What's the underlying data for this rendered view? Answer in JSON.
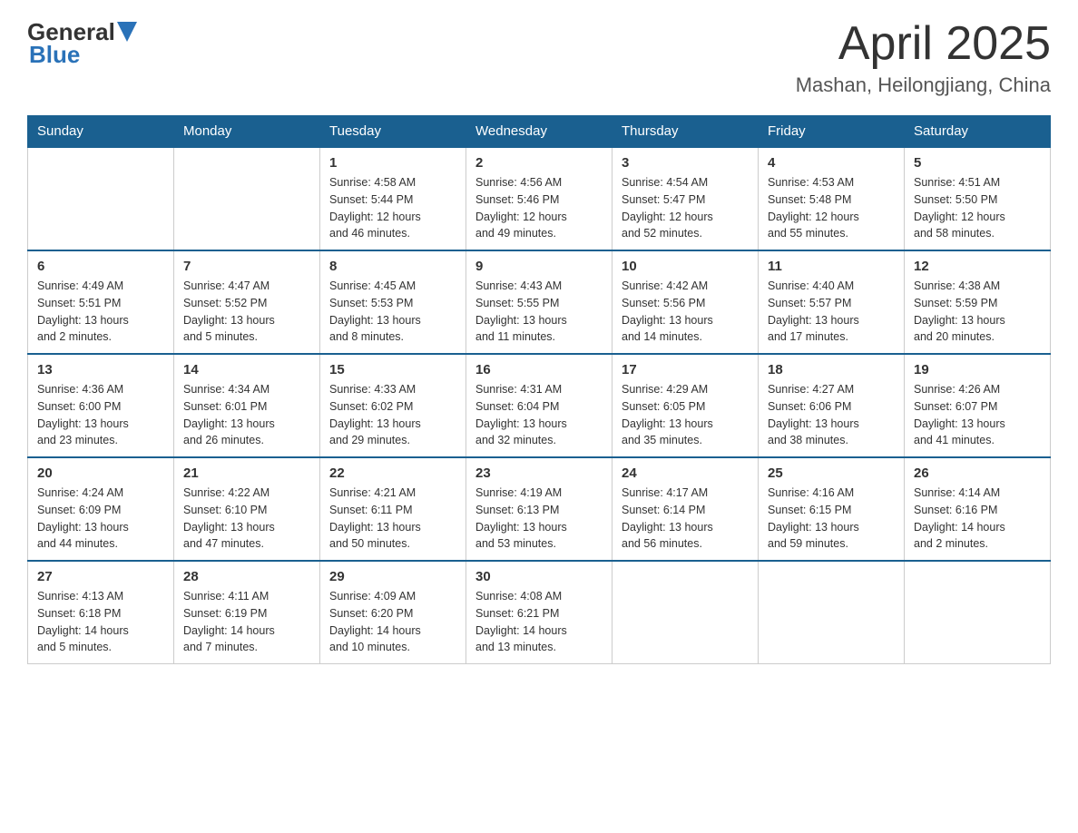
{
  "header": {
    "logo": {
      "general": "General",
      "blue": "Blue"
    },
    "month": "April 2025",
    "location": "Mashan, Heilongjiang, China"
  },
  "weekdays": [
    "Sunday",
    "Monday",
    "Tuesday",
    "Wednesday",
    "Thursday",
    "Friday",
    "Saturday"
  ],
  "weeks": [
    [
      {
        "day": "",
        "info": ""
      },
      {
        "day": "",
        "info": ""
      },
      {
        "day": "1",
        "info": "Sunrise: 4:58 AM\nSunset: 5:44 PM\nDaylight: 12 hours\nand 46 minutes."
      },
      {
        "day": "2",
        "info": "Sunrise: 4:56 AM\nSunset: 5:46 PM\nDaylight: 12 hours\nand 49 minutes."
      },
      {
        "day": "3",
        "info": "Sunrise: 4:54 AM\nSunset: 5:47 PM\nDaylight: 12 hours\nand 52 minutes."
      },
      {
        "day": "4",
        "info": "Sunrise: 4:53 AM\nSunset: 5:48 PM\nDaylight: 12 hours\nand 55 minutes."
      },
      {
        "day": "5",
        "info": "Sunrise: 4:51 AM\nSunset: 5:50 PM\nDaylight: 12 hours\nand 58 minutes."
      }
    ],
    [
      {
        "day": "6",
        "info": "Sunrise: 4:49 AM\nSunset: 5:51 PM\nDaylight: 13 hours\nand 2 minutes."
      },
      {
        "day": "7",
        "info": "Sunrise: 4:47 AM\nSunset: 5:52 PM\nDaylight: 13 hours\nand 5 minutes."
      },
      {
        "day": "8",
        "info": "Sunrise: 4:45 AM\nSunset: 5:53 PM\nDaylight: 13 hours\nand 8 minutes."
      },
      {
        "day": "9",
        "info": "Sunrise: 4:43 AM\nSunset: 5:55 PM\nDaylight: 13 hours\nand 11 minutes."
      },
      {
        "day": "10",
        "info": "Sunrise: 4:42 AM\nSunset: 5:56 PM\nDaylight: 13 hours\nand 14 minutes."
      },
      {
        "day": "11",
        "info": "Sunrise: 4:40 AM\nSunset: 5:57 PM\nDaylight: 13 hours\nand 17 minutes."
      },
      {
        "day": "12",
        "info": "Sunrise: 4:38 AM\nSunset: 5:59 PM\nDaylight: 13 hours\nand 20 minutes."
      }
    ],
    [
      {
        "day": "13",
        "info": "Sunrise: 4:36 AM\nSunset: 6:00 PM\nDaylight: 13 hours\nand 23 minutes."
      },
      {
        "day": "14",
        "info": "Sunrise: 4:34 AM\nSunset: 6:01 PM\nDaylight: 13 hours\nand 26 minutes."
      },
      {
        "day": "15",
        "info": "Sunrise: 4:33 AM\nSunset: 6:02 PM\nDaylight: 13 hours\nand 29 minutes."
      },
      {
        "day": "16",
        "info": "Sunrise: 4:31 AM\nSunset: 6:04 PM\nDaylight: 13 hours\nand 32 minutes."
      },
      {
        "day": "17",
        "info": "Sunrise: 4:29 AM\nSunset: 6:05 PM\nDaylight: 13 hours\nand 35 minutes."
      },
      {
        "day": "18",
        "info": "Sunrise: 4:27 AM\nSunset: 6:06 PM\nDaylight: 13 hours\nand 38 minutes."
      },
      {
        "day": "19",
        "info": "Sunrise: 4:26 AM\nSunset: 6:07 PM\nDaylight: 13 hours\nand 41 minutes."
      }
    ],
    [
      {
        "day": "20",
        "info": "Sunrise: 4:24 AM\nSunset: 6:09 PM\nDaylight: 13 hours\nand 44 minutes."
      },
      {
        "day": "21",
        "info": "Sunrise: 4:22 AM\nSunset: 6:10 PM\nDaylight: 13 hours\nand 47 minutes."
      },
      {
        "day": "22",
        "info": "Sunrise: 4:21 AM\nSunset: 6:11 PM\nDaylight: 13 hours\nand 50 minutes."
      },
      {
        "day": "23",
        "info": "Sunrise: 4:19 AM\nSunset: 6:13 PM\nDaylight: 13 hours\nand 53 minutes."
      },
      {
        "day": "24",
        "info": "Sunrise: 4:17 AM\nSunset: 6:14 PM\nDaylight: 13 hours\nand 56 minutes."
      },
      {
        "day": "25",
        "info": "Sunrise: 4:16 AM\nSunset: 6:15 PM\nDaylight: 13 hours\nand 59 minutes."
      },
      {
        "day": "26",
        "info": "Sunrise: 4:14 AM\nSunset: 6:16 PM\nDaylight: 14 hours\nand 2 minutes."
      }
    ],
    [
      {
        "day": "27",
        "info": "Sunrise: 4:13 AM\nSunset: 6:18 PM\nDaylight: 14 hours\nand 5 minutes."
      },
      {
        "day": "28",
        "info": "Sunrise: 4:11 AM\nSunset: 6:19 PM\nDaylight: 14 hours\nand 7 minutes."
      },
      {
        "day": "29",
        "info": "Sunrise: 4:09 AM\nSunset: 6:20 PM\nDaylight: 14 hours\nand 10 minutes."
      },
      {
        "day": "30",
        "info": "Sunrise: 4:08 AM\nSunset: 6:21 PM\nDaylight: 14 hours\nand 13 minutes."
      },
      {
        "day": "",
        "info": ""
      },
      {
        "day": "",
        "info": ""
      },
      {
        "day": "",
        "info": ""
      }
    ]
  ]
}
